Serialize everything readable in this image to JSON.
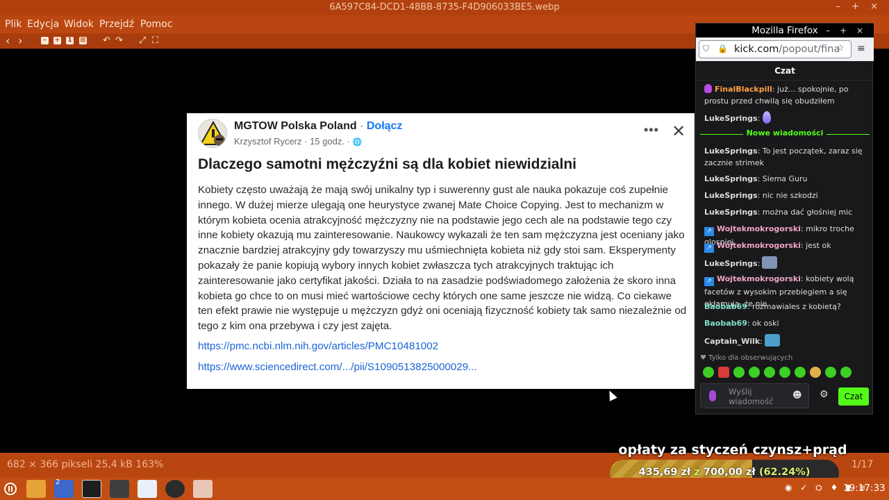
{
  "viewer": {
    "window_title": "6A597C84-DCD1-48BB-8735-F4D906033BE5.webp",
    "window_controls": "–  +  ×",
    "menu": [
      "Plik",
      "Edycja",
      "Widok",
      "Przejdź",
      "Pomoc"
    ],
    "toolbar_glyphs": {
      "back": "‹",
      "forward": "›",
      "zoom_out": "–",
      "zoom_in": "+",
      "zoom_1": "1",
      "zoom_fit": "⊞",
      "rotate_left": "↶",
      "rotate_right": "↷",
      "fullscreen": "⤢",
      "slideshow": "⛶"
    },
    "status": "682 × 366 pikseli   25,4 kB   163%",
    "page_count": "1/17"
  },
  "post": {
    "group_name": "MGTOW Polska Poland",
    "separator": "·",
    "join_label": "Dołącz",
    "author": "Krzysztof Rycerz",
    "time": "15 godz.",
    "globe": "🌐",
    "more_label": "•••",
    "close_label": "✕",
    "title": "Dlaczego samotni mężczyźni są dla kobiet niewidzialni",
    "body": "Kobiety często uważają że mają swój unikalny typ i suwerenny gust ale nauka pokazuje coś zupełnie innego. W dużej mierze ulegają one heurystyce zwanej Mate Choice Copying. Jest to mechanizm w którym kobieta ocenia atrakcyjność mężczyzny nie na podstawie jego cech ale na podstawie tego czy inne kobiety okazują mu zainteresowanie. Naukowcy wykazali że ten sam mężczyzna jest oceniany jako znacznie bardziej atrakcyjny gdy towarzyszy mu uśmiechnięta kobieta niż gdy stoi sam. Eksperymenty pokazały że panie kopiują wybory innych kobiet zwłaszcza tych atrakcyjnych traktując ich zainteresowanie jako certyfikat jakości. Działa to na zasadzie podświadomego założenia że skoro inna kobieta go chce to on musi mieć wartościowe cechy których one same jeszcze nie widzą. Co ciekawe ten efekt prawie nie występuje u mężczyzn gdyż oni oceniają fizyczność kobiety tak samo niezależnie od tego z kim ona przebywa i czy jest zajęta.",
    "links": [
      "https://pmc.ncbi.nlm.nih.gov/articles/PMC10481002",
      "https://www.sciencedirect.com/.../pii/S1090513825000029..."
    ]
  },
  "firefox": {
    "title": "Mozilla Firefox",
    "controls": "– + ×",
    "url_domain": "kick.com",
    "url_path": "/popout/fina",
    "icons": {
      "shield": "⛉",
      "lock": "🔒",
      "star": "☆",
      "menu": "≡"
    },
    "chat_header": "Czat",
    "messages": [
      {
        "user": "FinalBlackpill",
        "text": "już... spokojnie, po prostu przed chwilą się obudziłem"
      },
      {
        "user": "LukeSprings",
        "text": ""
      },
      {
        "user": "LukeSprings",
        "text": "To jest początek, zaraz się zacznie strimek"
      },
      {
        "user": "LukeSprings",
        "text": "Siema Guru"
      },
      {
        "user": "LukeSprings",
        "text": "nic nie szkodzi"
      },
      {
        "user": "LukeSprings",
        "text": "można dać głośniej mic"
      },
      {
        "user": "Wojtekmokrogorski",
        "text": "mikro troche glosniej"
      },
      {
        "user": "Wojtekmokrogorski",
        "text": "jest ok"
      },
      {
        "user": "LukeSprings",
        "text": ""
      },
      {
        "user": "Wojtekmokrogorski",
        "text": "kobiety wolą facetów z wysokim przebiegiem a się okłamują, że nie"
      },
      {
        "user": "Baobab69",
        "text": "rozmawiales z kobietą?"
      },
      {
        "user": "Baobab69",
        "text": "ok oski"
      },
      {
        "user": "Captain_Wilk",
        "text": ""
      }
    ],
    "new_messages_label": "Nowe wiadomości",
    "followers_only": "♥ Tylko dla obserwujących",
    "input_placeholder": "Wyślij wiadomość",
    "smile_icon": "☻",
    "gear_icon": "⚙",
    "send_label": "Czat"
  },
  "donation": {
    "title": "opłaty za styczeń czynsz+prąd",
    "current": "435,69 zł",
    "separator": "z",
    "goal": "700,00 zł",
    "percent_label": "(62.24%)",
    "fraction": 0.6224
  },
  "taskbar": {
    "badge_count": "2",
    "clock": "19:17:33",
    "tray_glyphs": "◉ ✓ ⛭ ♦ ▮ ≡"
  }
}
